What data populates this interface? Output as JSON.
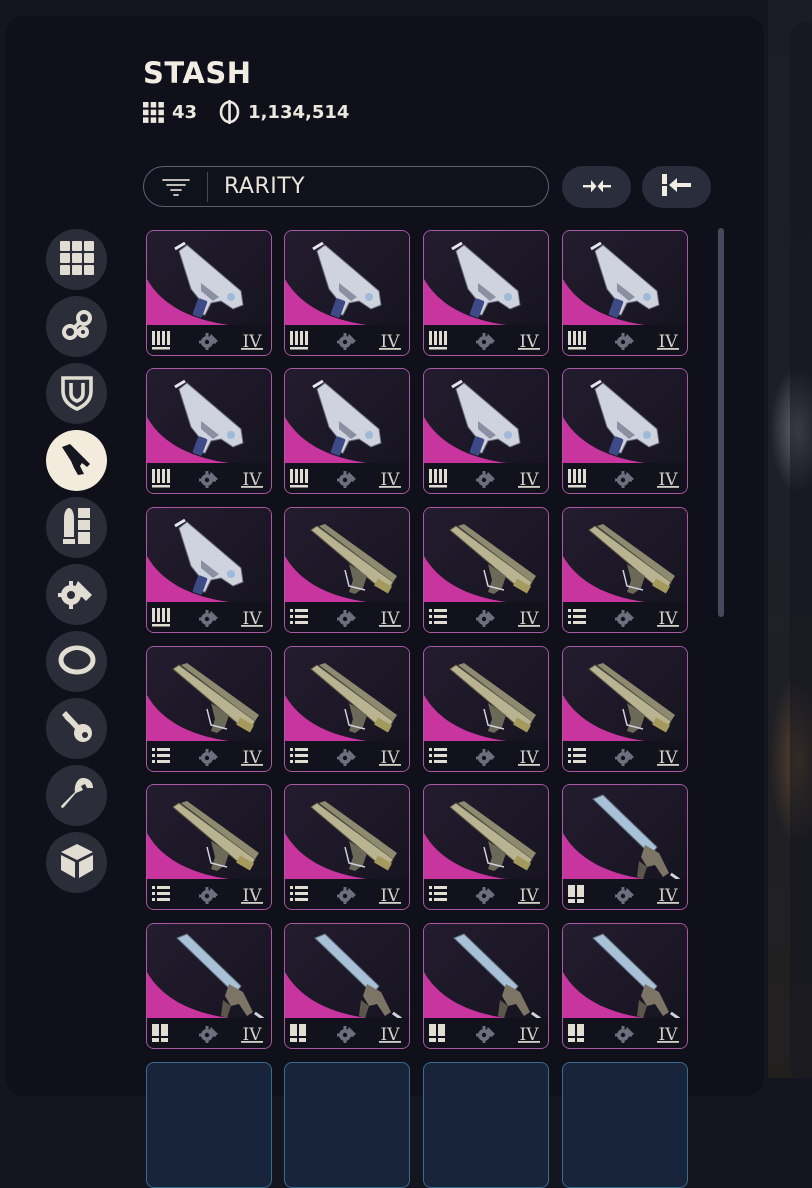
{
  "header": {
    "title": "STASH",
    "slots_count": "43",
    "currency_amount": "1,134,514",
    "slots_icon": "grid-icon",
    "currency_icon": "currency-icon"
  },
  "toolbar": {
    "sort_label": "RARITY",
    "filter_icon": "filter-icon",
    "collapse_button_icon": "arrows-inward-icon",
    "stack_button_icon": "collapse-left-icon"
  },
  "categories": [
    {
      "name": "all-items",
      "icon": "grid-icon"
    },
    {
      "name": "attachments",
      "icon": "chain-link-icon"
    },
    {
      "name": "armor",
      "icon": "shield-icon"
    },
    {
      "name": "weapons",
      "icon": "pistol-icon",
      "active": true
    },
    {
      "name": "ammo",
      "icon": "ammo-icon"
    },
    {
      "name": "mods",
      "icon": "gear-blade-icon"
    },
    {
      "name": "gadgets",
      "icon": "ring-icon"
    },
    {
      "name": "keys",
      "icon": "key-icon"
    },
    {
      "name": "tools",
      "icon": "wrench-icon"
    },
    {
      "name": "crates",
      "icon": "cube-icon"
    }
  ],
  "colors": {
    "rarity_epic": "#c8359e",
    "card_border": "#a95aa2",
    "active_category": "#f3ecdc"
  },
  "items": [
    {
      "weapon": "smg",
      "ammo_icon": "bullets-icon",
      "tier": "IV"
    },
    {
      "weapon": "smg",
      "ammo_icon": "bullets-icon",
      "tier": "IV"
    },
    {
      "weapon": "smg",
      "ammo_icon": "bullets-icon",
      "tier": "IV"
    },
    {
      "weapon": "smg",
      "ammo_icon": "bullets-icon",
      "tier": "IV"
    },
    {
      "weapon": "smg",
      "ammo_icon": "bullets-icon",
      "tier": "IV"
    },
    {
      "weapon": "smg",
      "ammo_icon": "bullets-icon",
      "tier": "IV"
    },
    {
      "weapon": "smg",
      "ammo_icon": "bullets-icon",
      "tier": "IV"
    },
    {
      "weapon": "smg",
      "ammo_icon": "bullets-icon",
      "tier": "IV"
    },
    {
      "weapon": "smg",
      "ammo_icon": "bullets-icon",
      "tier": "IV"
    },
    {
      "weapon": "rifle",
      "ammo_icon": "magazine-icon",
      "tier": "IV"
    },
    {
      "weapon": "rifle",
      "ammo_icon": "magazine-icon",
      "tier": "IV"
    },
    {
      "weapon": "rifle",
      "ammo_icon": "magazine-icon",
      "tier": "IV"
    },
    {
      "weapon": "rifle",
      "ammo_icon": "magazine-icon",
      "tier": "IV"
    },
    {
      "weapon": "rifle",
      "ammo_icon": "magazine-icon",
      "tier": "IV"
    },
    {
      "weapon": "rifle",
      "ammo_icon": "magazine-icon",
      "tier": "IV"
    },
    {
      "weapon": "rifle",
      "ammo_icon": "magazine-icon",
      "tier": "IV"
    },
    {
      "weapon": "rifle",
      "ammo_icon": "magazine-icon",
      "tier": "IV"
    },
    {
      "weapon": "rifle",
      "ammo_icon": "magazine-icon",
      "tier": "IV"
    },
    {
      "weapon": "rifle",
      "ammo_icon": "magazine-icon",
      "tier": "IV"
    },
    {
      "weapon": "launcher",
      "ammo_icon": "shells-icon",
      "tier": "IV"
    },
    {
      "weapon": "launcher",
      "ammo_icon": "shells-icon",
      "tier": "IV"
    },
    {
      "weapon": "launcher",
      "ammo_icon": "shells-icon",
      "tier": "IV"
    },
    {
      "weapon": "launcher",
      "ammo_icon": "shells-icon",
      "tier": "IV"
    },
    {
      "weapon": "launcher",
      "ammo_icon": "shells-icon",
      "tier": "IV"
    },
    {
      "weapon": "next",
      "ammo_icon": "",
      "tier": ""
    },
    {
      "weapon": "next",
      "ammo_icon": "",
      "tier": ""
    },
    {
      "weapon": "next",
      "ammo_icon": "",
      "tier": ""
    },
    {
      "weapon": "next",
      "ammo_icon": "",
      "tier": ""
    }
  ]
}
